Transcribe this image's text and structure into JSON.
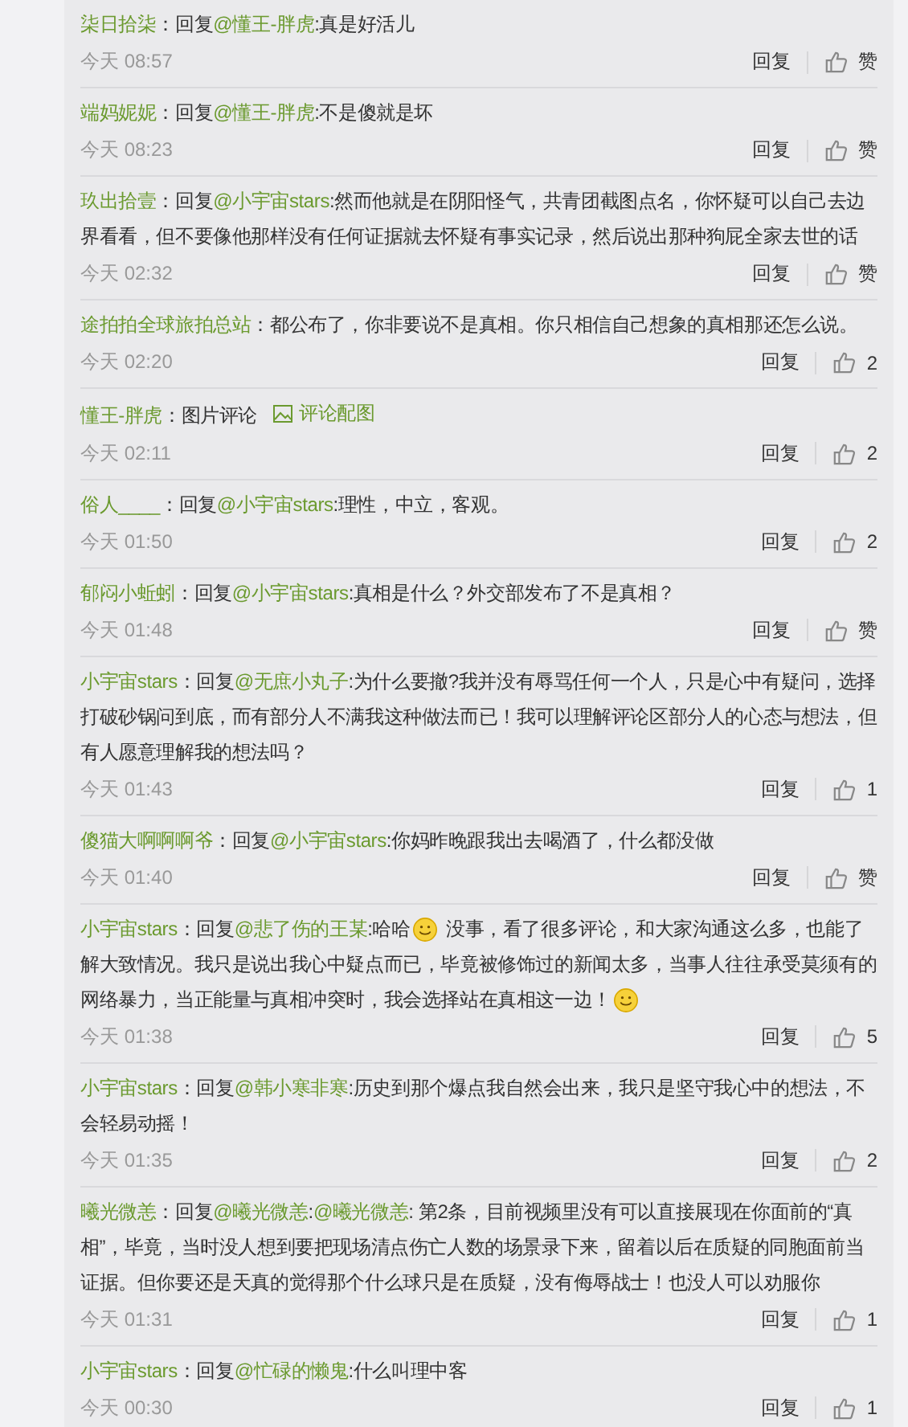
{
  "comments": [
    {
      "parts": [
        {
          "kind": "user",
          "text": "柒日拾柒"
        },
        {
          "kind": "text",
          "text": "：回复"
        },
        {
          "kind": "mention",
          "text": "@懂王-胖虎"
        },
        {
          "kind": "text",
          "text": ":真是好活儿"
        }
      ],
      "time": "今天 08:57",
      "reply": "回复",
      "likes": "赞"
    },
    {
      "parts": [
        {
          "kind": "user",
          "text": "端妈妮妮"
        },
        {
          "kind": "text",
          "text": "：回复"
        },
        {
          "kind": "mention",
          "text": "@懂王-胖虎"
        },
        {
          "kind": "text",
          "text": ":不是傻就是坏"
        }
      ],
      "time": "今天 08:23",
      "reply": "回复",
      "likes": "赞"
    },
    {
      "parts": [
        {
          "kind": "user",
          "text": "玖出拾壹"
        },
        {
          "kind": "text",
          "text": "：回复"
        },
        {
          "kind": "mention",
          "text": "@小宇宙stars"
        },
        {
          "kind": "text",
          "text": ":然而他就是在阴阳怪气，共青团截图点名，你怀疑可以自己去边界看看，但不要像他那样没有任何证据就去怀疑有事实记录，然后说出那种狗屁全家去世的话"
        }
      ],
      "time": "今天 02:32",
      "reply": "回复",
      "likes": "赞"
    },
    {
      "parts": [
        {
          "kind": "user",
          "text": "途拍拍全球旅拍总站"
        },
        {
          "kind": "text",
          "text": "：都公布了，你非要说不是真相。你只相信自己想象的真相那还怎么说。"
        }
      ],
      "time": "今天 02:20",
      "reply": "回复",
      "likes": "2"
    },
    {
      "parts": [
        {
          "kind": "user",
          "text": "懂王-胖虎"
        },
        {
          "kind": "text",
          "text": "：图片评论"
        },
        {
          "kind": "image-link",
          "text": "评论配图"
        }
      ],
      "time": "今天 02:11",
      "reply": "回复",
      "likes": "2"
    },
    {
      "parts": [
        {
          "kind": "user",
          "text": "俗人____"
        },
        {
          "kind": "text",
          "text": "：回复"
        },
        {
          "kind": "mention",
          "text": "@小宇宙stars"
        },
        {
          "kind": "text",
          "text": ":理性，中立，客观。"
        }
      ],
      "time": "今天 01:50",
      "reply": "回复",
      "likes": "2"
    },
    {
      "parts": [
        {
          "kind": "user",
          "text": "郁闷小蚯蚓"
        },
        {
          "kind": "text",
          "text": "：回复"
        },
        {
          "kind": "mention",
          "text": "@小宇宙stars"
        },
        {
          "kind": "text",
          "text": ":真相是什么？外交部发布了不是真相？"
        }
      ],
      "time": "今天 01:48",
      "reply": "回复",
      "likes": "赞"
    },
    {
      "parts": [
        {
          "kind": "user",
          "text": "小宇宙stars"
        },
        {
          "kind": "text",
          "text": "：回复"
        },
        {
          "kind": "mention",
          "text": "@无庶小丸子"
        },
        {
          "kind": "text",
          "text": ":为什么要撤?我并没有辱骂任何一个人，只是心中有疑问，选择打破砂锅问到底，而有部分人不满我这种做法而已！我可以理解评论区部分人的心态与想法，但有人愿意理解我的想法吗？"
        }
      ],
      "time": "今天 01:43",
      "reply": "回复",
      "likes": "1"
    },
    {
      "parts": [
        {
          "kind": "user",
          "text": "傻猫大啊啊啊爷"
        },
        {
          "kind": "text",
          "text": "：回复"
        },
        {
          "kind": "mention",
          "text": "@小宇宙stars"
        },
        {
          "kind": "text",
          "text": ":你妈昨晚跟我出去喝酒了，什么都没做"
        }
      ],
      "time": "今天 01:40",
      "reply": "回复",
      "likes": "赞"
    },
    {
      "parts": [
        {
          "kind": "user",
          "text": "小宇宙stars"
        },
        {
          "kind": "text",
          "text": "：回复"
        },
        {
          "kind": "mention",
          "text": "@悲了伤的王某"
        },
        {
          "kind": "text",
          "text": ":哈哈"
        },
        {
          "kind": "emoji"
        },
        {
          "kind": "text",
          "text": " 没事，看了很多评论，和大家沟通这么多，也能了解大致情况。我只是说出我心中疑点而已，毕竟被修饰过的新闻太多，当事人往往承受莫须有的网络暴力，当正能量与真相冲突时，我会选择站在真相这一边！"
        },
        {
          "kind": "emoji"
        }
      ],
      "time": "今天 01:38",
      "reply": "回复",
      "likes": "5"
    },
    {
      "parts": [
        {
          "kind": "user",
          "text": "小宇宙stars"
        },
        {
          "kind": "text",
          "text": "：回复"
        },
        {
          "kind": "mention",
          "text": "@韩小寒非寒"
        },
        {
          "kind": "text",
          "text": ":历史到那个爆点我自然会出来，我只是坚守我心中的想法，不会轻易动摇！"
        }
      ],
      "time": "今天 01:35",
      "reply": "回复",
      "likes": "2"
    },
    {
      "parts": [
        {
          "kind": "user",
          "text": "曦光微恙"
        },
        {
          "kind": "text",
          "text": "：回复"
        },
        {
          "kind": "mention",
          "text": "@曦光微恙"
        },
        {
          "kind": "text",
          "text": ":"
        },
        {
          "kind": "mention",
          "text": "@曦光微恙"
        },
        {
          "kind": "text",
          "text": ": 第2条，目前视频里没有可以直接展现在你面前的“真相”，毕竟，当时没人想到要把现场清点伤亡人数的场景录下来，留着以后在质疑的同胞面前当证据。但你要还是天真的觉得那个什么球只是在质疑，没有侮辱战士！也没人可以劝服你"
        }
      ],
      "time": "今天 01:31",
      "reply": "回复",
      "likes": "1"
    },
    {
      "parts": [
        {
          "kind": "user",
          "text": "小宇宙stars"
        },
        {
          "kind": "text",
          "text": "：回复"
        },
        {
          "kind": "mention",
          "text": "@忙碌的懒鬼"
        },
        {
          "kind": "text",
          "text": ":什么叫理中客"
        }
      ],
      "time": "今天 00:30",
      "reply": "回复",
      "likes": "1"
    }
  ]
}
